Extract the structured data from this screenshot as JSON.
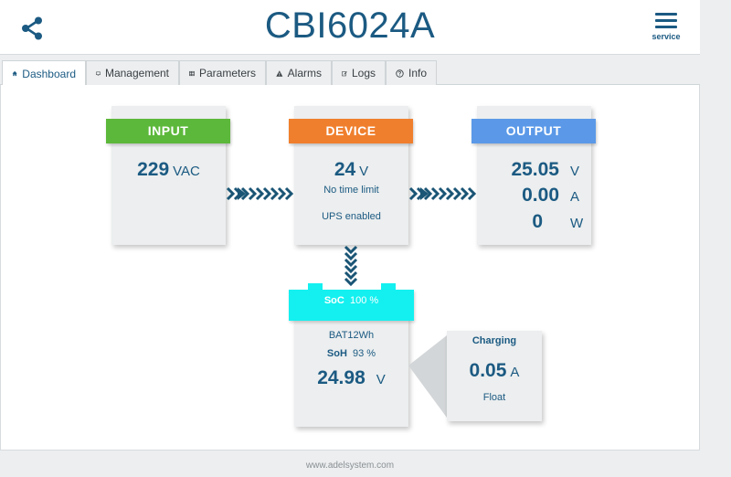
{
  "header": {
    "title": "CBI6024A",
    "menu_label": "service"
  },
  "tabs": [
    {
      "label": "Dashboard",
      "icon": "home-icon",
      "active": true
    },
    {
      "label": "Management",
      "icon": "monitor-icon"
    },
    {
      "label": "Parameters",
      "icon": "table-icon"
    },
    {
      "label": "Alarms",
      "icon": "warning-icon"
    },
    {
      "label": "Logs",
      "icon": "edit-icon"
    },
    {
      "label": "Info",
      "icon": "question-icon"
    }
  ],
  "input": {
    "title": "INPUT",
    "value": "229",
    "unit": "VAC",
    "color": "#5cb83a"
  },
  "device": {
    "title": "DEVICE",
    "value": "24",
    "unit": "V",
    "line1": "No time limit",
    "line2": "UPS enabled",
    "color": "#f07f2d"
  },
  "output": {
    "title": "OUTPUT",
    "voltage": "25.05",
    "voltage_unit": "V",
    "current": "0.00",
    "current_unit": "A",
    "power": "0",
    "power_unit": "W",
    "color": "#5b99e8"
  },
  "battery": {
    "soc_label": "SoC",
    "soc_value": "100 %",
    "name": "BAT12Wh",
    "soh_label": "SoH",
    "soh_value": "93 %",
    "voltage": "24.98",
    "voltage_unit": "V",
    "soc_color": "#14f0f0"
  },
  "charging": {
    "title": "Charging",
    "current": "0.05",
    "current_unit": "A",
    "mode": "Float"
  },
  "footer": {
    "text": "www.adelsystem.com"
  },
  "colors": {
    "accent": "#1b5a82",
    "chevron": "#1a5575"
  }
}
